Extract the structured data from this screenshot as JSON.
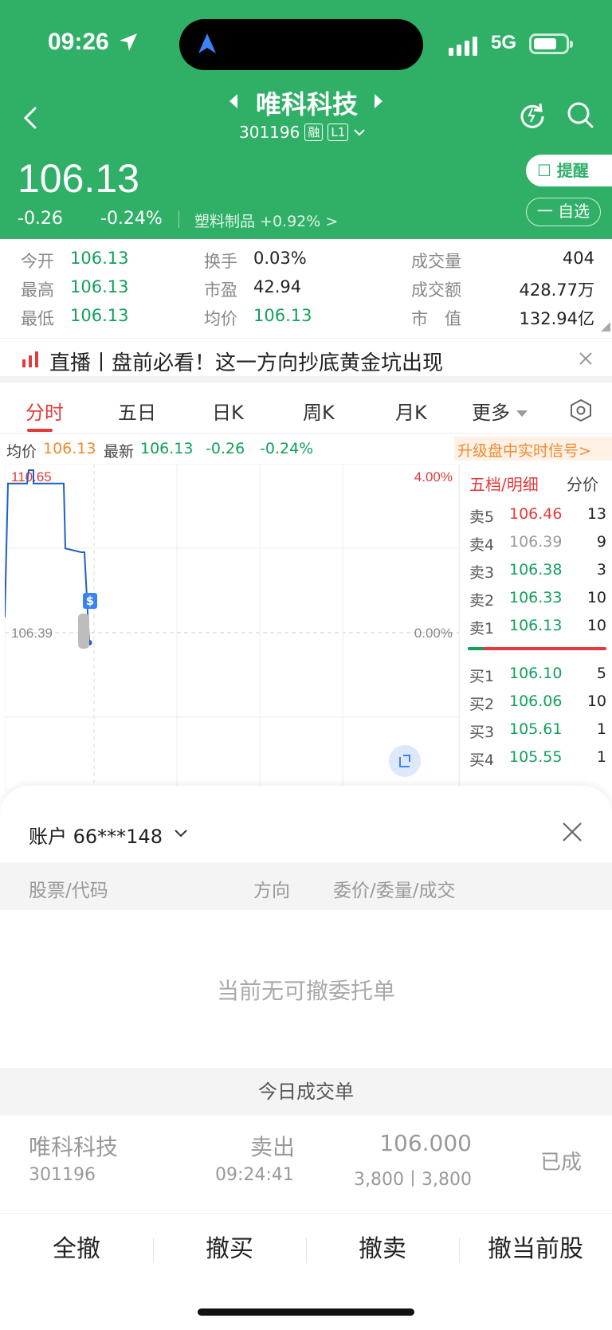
{
  "status_bar": {
    "time": "09:26",
    "network": "5G"
  },
  "header": {
    "stock_name": "唯科科技",
    "stock_code": "301196",
    "tag_margin": "融",
    "tag_level": "L1"
  },
  "quote": {
    "price": "106.13",
    "change": "-0.26",
    "change_pct": "-0.24%",
    "sector": "塑料制品 +0.92% >",
    "remind_label": "提醒",
    "watchlist_label": "一 自选"
  },
  "stats": [
    {
      "label": "今开",
      "value": "106.13"
    },
    {
      "label": "最高",
      "value": "106.13"
    },
    {
      "label": "最低",
      "value": "106.13"
    },
    {
      "label": "换手",
      "value": "0.03%"
    },
    {
      "label": "市盈",
      "value": "42.94"
    },
    {
      "label": "均价",
      "value": "106.13"
    },
    {
      "label": "成交量",
      "value": "404"
    },
    {
      "label": "成交额",
      "value": "428.77万"
    },
    {
      "label": "市　值",
      "value": "132.94亿"
    }
  ],
  "news": {
    "text": "直播丨盘前必看！这一方向抄底黄金坑出现"
  },
  "tabs": [
    "分时",
    "五日",
    "日K",
    "周K",
    "月K",
    "更多"
  ],
  "avg_row": {
    "avg_label": "均价",
    "avg_value": "106.13",
    "latest_label": "最新",
    "latest_value": "106.13",
    "change": "-0.26",
    "change_pct": "-0.24%",
    "upgrade": "升级盘中实时信号>"
  },
  "chart_data": {
    "type": "line",
    "y_labels": {
      "top": "110.65",
      "mid": "106.39",
      "top_pct": "4.00%",
      "mid_pct": "0.00%"
    },
    "marker": "$",
    "series": [
      {
        "values": [
          106.8,
          110.3,
          110.3,
          110.65,
          110.65,
          110.3,
          110.3,
          110.3,
          108.6,
          108.5,
          108.5,
          106.13
        ]
      }
    ]
  },
  "orderbook": {
    "tab_active": "五档/明细",
    "tab_other": "分价",
    "asks": [
      {
        "label": "卖5",
        "price": "106.46",
        "qty": "13",
        "color": "red"
      },
      {
        "label": "卖4",
        "price": "106.39",
        "qty": "9",
        "color": "grey"
      },
      {
        "label": "卖3",
        "price": "106.38",
        "qty": "3",
        "color": "green"
      },
      {
        "label": "卖2",
        "price": "106.33",
        "qty": "10",
        "color": "green"
      },
      {
        "label": "卖1",
        "price": "106.13",
        "qty": "10",
        "color": "green"
      }
    ],
    "bids": [
      {
        "label": "买1",
        "price": "106.10",
        "qty": "5",
        "color": "green"
      },
      {
        "label": "买2",
        "price": "106.06",
        "qty": "10",
        "color": "green"
      },
      {
        "label": "买3",
        "price": "105.61",
        "qty": "1",
        "color": "green"
      },
      {
        "label": "买4",
        "price": "105.55",
        "qty": "1",
        "color": "green"
      }
    ]
  },
  "sheet": {
    "account": "账户 66***148",
    "headers": {
      "stock": "股票/代码",
      "direction": "方向",
      "order": "委价/委量/成交"
    },
    "empty_text": "当前无可撤委托单",
    "today_title": "今日成交单",
    "trade": {
      "name": "唯科科技",
      "code": "301196",
      "direction": "卖出",
      "time": "09:24:41",
      "price": "106.000",
      "qty": "3,800丨3,800",
      "status": "已成"
    },
    "actions": [
      "全撤",
      "撤买",
      "撤卖",
      "撤当前股"
    ]
  }
}
